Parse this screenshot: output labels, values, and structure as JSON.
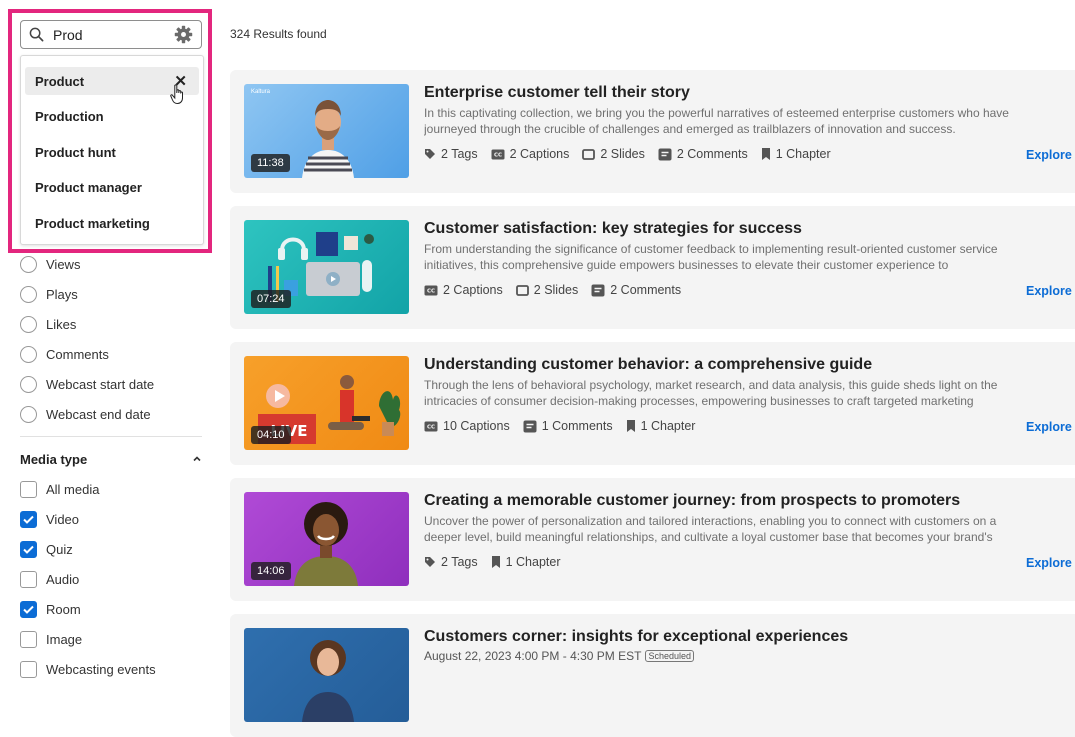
{
  "search": {
    "value": "Prod"
  },
  "suggestions": [
    "Product",
    "Production",
    "Product hunt",
    "Product manager",
    "Product marketing"
  ],
  "sort_options": [
    "Views",
    "Plays",
    "Likes",
    "Comments",
    "Webcast start date",
    "Webcast end date"
  ],
  "media_type": {
    "heading": "Media type",
    "options": [
      {
        "label": "All media",
        "checked": false
      },
      {
        "label": "Video",
        "checked": true
      },
      {
        "label": "Quiz",
        "checked": true
      },
      {
        "label": "Audio",
        "checked": false
      },
      {
        "label": "Room",
        "checked": true
      },
      {
        "label": "Image",
        "checked": false
      },
      {
        "label": "Webcasting events",
        "checked": false
      }
    ]
  },
  "results_count": "324 Results found",
  "explore_label": "Explore",
  "accent": "#0c6cd5",
  "highlight": "#e3267e",
  "cards": [
    {
      "title": "Enterprise customer tell their story",
      "description": "In this captivating collection, we bring you the powerful narratives of esteemed enterprise customers who have journeyed through the crucible of challenges and emerged as trailblazers of innovation and success.",
      "duration": "11:38",
      "thumb_label": "Kaltura",
      "meta": [
        {
          "icon": "tag-icon",
          "text": "2 Tags"
        },
        {
          "icon": "captions-icon",
          "text": "2 Captions"
        },
        {
          "icon": "slides-icon",
          "text": "2 Slides"
        },
        {
          "icon": "comments-icon",
          "text": "2 Comments"
        },
        {
          "icon": "chapter-icon",
          "text": "1 Chapter"
        }
      ]
    },
    {
      "title": "Customer satisfaction: key strategies for success",
      "description": "From understanding the significance of customer feedback to implementing result-oriented customer service initiatives, this comprehensive guide empowers businesses to elevate their customer experience to",
      "duration": "07:24",
      "meta": [
        {
          "icon": "captions-icon",
          "text": "2 Captions"
        },
        {
          "icon": "slides-icon",
          "text": "2 Slides"
        },
        {
          "icon": "comments-icon",
          "text": "2 Comments"
        }
      ]
    },
    {
      "title": "Understanding customer behavior: a comprehensive guide",
      "description": "Through the lens of behavioral psychology, market research, and data analysis, this guide sheds light on the intricacies of consumer decision-making processes, empowering businesses to craft targeted marketing",
      "duration": "04:10",
      "thumb_label": "LIVE",
      "meta": [
        {
          "icon": "captions-icon",
          "text": "10 Captions"
        },
        {
          "icon": "comments-icon",
          "text": "1 Comments"
        },
        {
          "icon": "chapter-icon",
          "text": "1 Chapter"
        }
      ]
    },
    {
      "title": "Creating a memorable customer journey: from prospects to promoters",
      "description": "Uncover the power of personalization and tailored interactions, enabling you to connect with customers on a deeper level, build meaningful relationships, and cultivate a loyal customer base that becomes your brand's",
      "duration": "14:06",
      "meta": [
        {
          "icon": "tag-icon",
          "text": "2 Tags"
        },
        {
          "icon": "chapter-icon",
          "text": "1 Chapter"
        }
      ]
    },
    {
      "title": "Customers corner: insights for exceptional experiences",
      "date": "August 22, 2023 4:00 PM - 4:30 PM EST",
      "badge": "Scheduled"
    }
  ]
}
